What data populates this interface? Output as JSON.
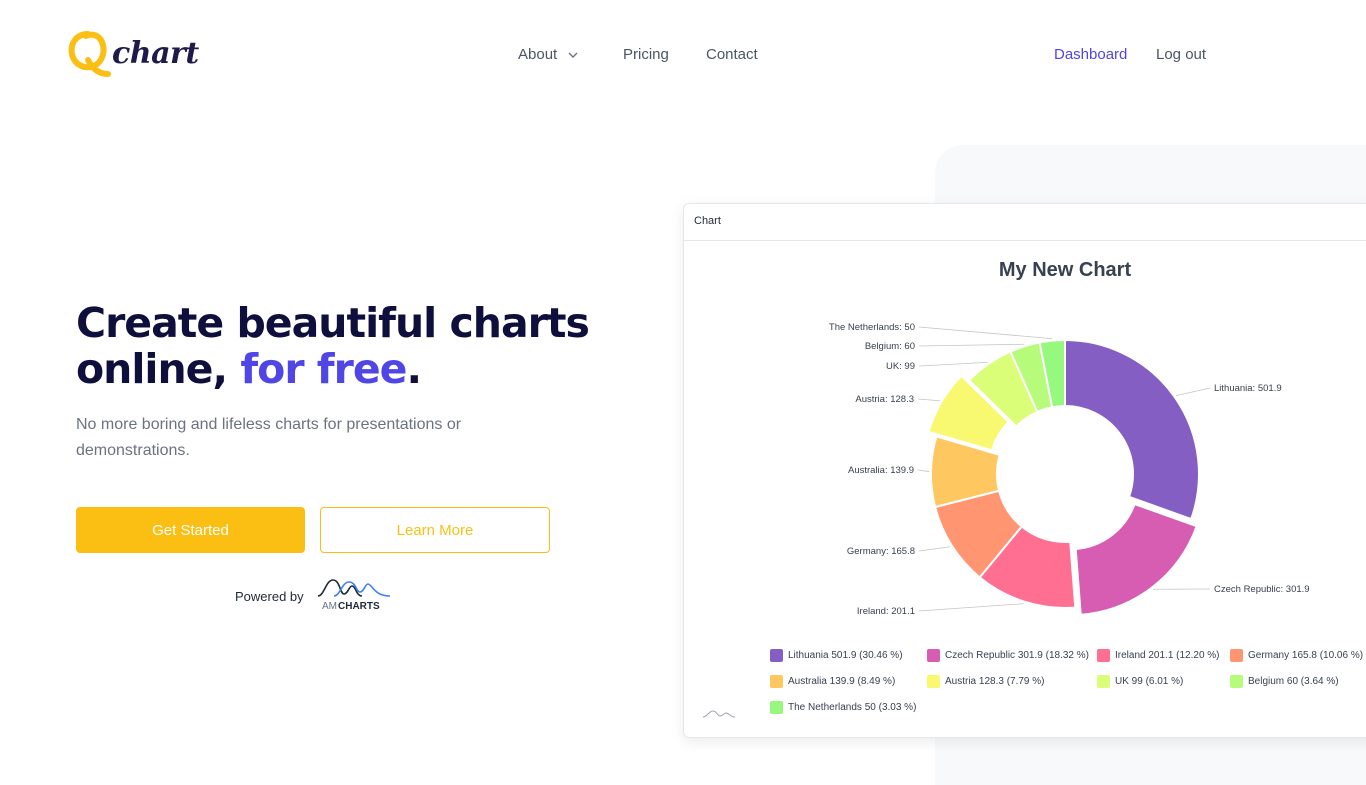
{
  "brand": {
    "name": "chart",
    "colors": {
      "accent": "#4f46e5",
      "yellow": "#fbbf14",
      "dark": "#0f0f3d"
    }
  },
  "nav": {
    "about": "About",
    "pricing": "Pricing",
    "contact": "Contact",
    "dashboard": "Dashboard",
    "logout": "Log out"
  },
  "hero": {
    "title_line1": "Create beautiful charts",
    "title_line2_a": "online, ",
    "title_line2_b": "for free",
    "title_line2_c": ".",
    "subtitle": "No more boring and lifeless charts for presentations or demonstrations.",
    "primary_button": "Get Started",
    "secondary_button": "Learn More",
    "powered_by": "Powered by",
    "powered_logo_text_a": "AM",
    "powered_logo_text_b": "CHARTS"
  },
  "card": {
    "header": "Chart"
  },
  "chart_data": {
    "type": "pie",
    "variant": "donut",
    "title": "My New Chart",
    "slices": [
      {
        "name": "Lithuania",
        "value": 501.9,
        "percent": "30.46 %",
        "color": "#845ec2",
        "label": "Lithuania: 501.9"
      },
      {
        "name": "Czech Republic",
        "value": 301.9,
        "percent": "18.32 %",
        "color": "#d65db1",
        "label": "Czech Republic: 301.9"
      },
      {
        "name": "Ireland",
        "value": 201.1,
        "percent": "12.20 %",
        "color": "#ff6f91",
        "label": "Ireland: 201.1"
      },
      {
        "name": "Germany",
        "value": 165.8,
        "percent": "10.06 %",
        "color": "#ff9671",
        "label": "Germany: 165.8"
      },
      {
        "name": "Australia",
        "value": 139.9,
        "percent": "8.49 %",
        "color": "#ffc75f",
        "label": "Australia: 139.9"
      },
      {
        "name": "Austria",
        "value": 128.3,
        "percent": "7.79 %",
        "color": "#f9f871",
        "label": "Austria: 128.3"
      },
      {
        "name": "UK",
        "value": 99,
        "percent": "6.01 %",
        "color": "#dbfe79",
        "label": "UK: 99"
      },
      {
        "name": "Belgium",
        "value": 60,
        "percent": "3.64 %",
        "color": "#b7fb7b",
        "label": "Belgium: 60"
      },
      {
        "name": "The Netherlands",
        "value": 50,
        "percent": "3.03 %",
        "color": "#96f97e",
        "label": "The Netherlands: 50"
      }
    ],
    "legend": [
      "Lithuania  501.9 (30.46 %)",
      "Czech Republic  301.9 (18.32 %)",
      "Ireland  201.1 (12.20 %)",
      "Germany  165.8 (10.06 %)",
      "Australia  139.9 (8.49 %)",
      "Austria  128.3 (7.79 %)",
      "UK  99 (6.01 %)",
      "Belgium  60 (3.64 %)",
      "The Netherlands  50 (3.03 %)"
    ],
    "pulled_slices": [
      "Czech Republic",
      "Austria"
    ],
    "legend_position": "bottom"
  }
}
